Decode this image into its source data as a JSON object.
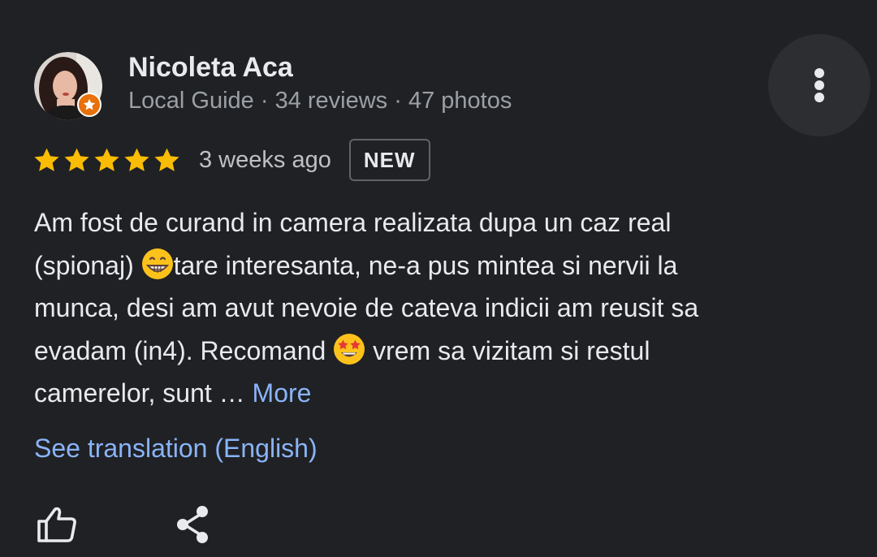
{
  "review": {
    "author": {
      "name": "Nicoleta Aca",
      "role": "Local Guide",
      "reviews": "34 reviews",
      "photos": "47 photos",
      "separator": " · ",
      "badge_icon": "local-guide-star-icon",
      "badge_color": "#e8710a"
    },
    "rating": {
      "stars": 5,
      "max": 5,
      "star_color": "#fbbc04"
    },
    "time": "3 weeks ago",
    "new_badge": "NEW",
    "text": {
      "line1": "Am fost de curand in camera realizata dupa un caz real",
      "line2_a": "(spionaj) ",
      "line2_emoji": "grinning-face-emoji",
      "line2_b": "tare interesanta, ne-a pus mintea si nervii la",
      "line3": "munca, desi am avut nevoie de cateva indicii am reusit sa",
      "line4_a": "evadam (in4). Recomand ",
      "line4_emoji": "star-struck-emoji",
      "line4_b": " vrem sa vizitam si restul",
      "line5": "camerelor, sunt … ",
      "more_label": "More"
    },
    "translation_link": "See translation (English)",
    "actions": {
      "like_icon": "thumbs-up-icon",
      "share_icon": "share-icon",
      "menu_icon": "more-vert-icon"
    }
  },
  "colors": {
    "background": "#202124",
    "text_primary": "#e8eaed",
    "text_secondary": "#9aa0a6",
    "link": "#8ab4f8"
  }
}
